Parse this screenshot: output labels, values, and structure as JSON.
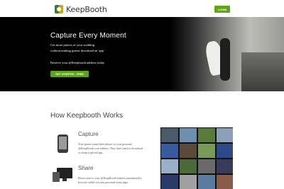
{
  "header": {
    "logo_text": "KeepBooth",
    "login_label": "LOGIN"
  },
  "hero": {
    "title": "Capture Every Moment",
    "line1": "Get more photos of your wedding",
    "line2": "without making guests download an 'app'",
    "line3": "Reserve your @Keepbooth address today",
    "cta_label": "GET STARTED - FREE"
  },
  "how_it_works": {
    "title": "How Keepbooth Works",
    "features": [
      {
        "title": "Capture",
        "desc_line1": "Your guests email their photos to your personal",
        "desc_line2": "@KeepBooth.com address. They don't need to download",
        "desc_line3": "or setup a special app.",
        "icon": "phone-icon"
      },
      {
        "title": "Share",
        "desc_line1": "Photos sent to your @KeepBooth address automatically",
        "desc_line2": "become visible on your personal event page.",
        "icon": "devices-icon"
      }
    ]
  },
  "colors": {
    "accent_green": "#5ea516",
    "hero_bg": "#000000",
    "photo_tiles": [
      "#4a5a6a",
      "#6d8fb0",
      "#5a7a3a",
      "#8aa0b8",
      "#3a5aa0",
      "#5a4a3a",
      "#7a9a5a",
      "#2a4a8a",
      "#9ab0c8",
      "#4a6a3a",
      "#6a6a6a",
      "#3a3a5a",
      "#2a3a6a",
      "#a0a0a0",
      "#5a7aa0",
      "#8a5a4a"
    ]
  }
}
